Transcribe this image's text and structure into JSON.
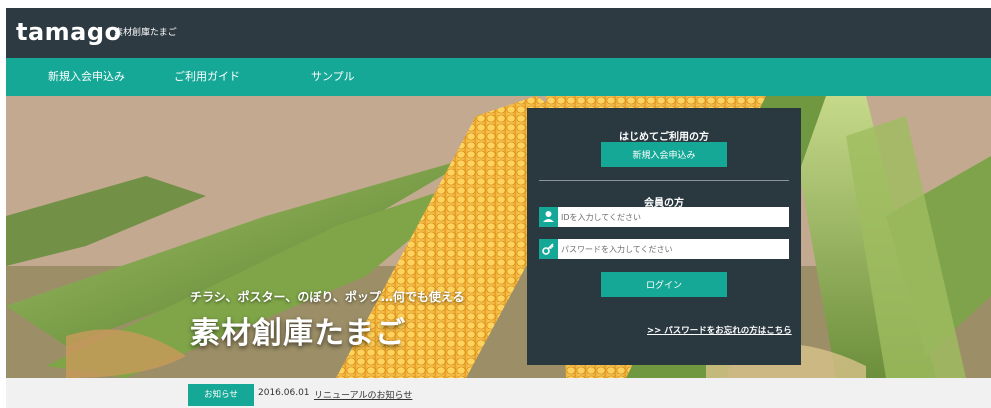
{
  "header": {
    "logo_text": "tamago",
    "logo_tagline": "素材創庫たまご"
  },
  "nav": {
    "items": [
      {
        "label": "新規入会申込み"
      },
      {
        "label": "ご利用ガイド"
      },
      {
        "label": "サンプル"
      }
    ]
  },
  "hero": {
    "subtitle": "チラシ、ポスター、のぼり、ポップ…何でも使える",
    "title": "素材創庫たまご"
  },
  "login_panel": {
    "first_time_heading": "はじめてご利用の方",
    "register_button": "新規入会申込み",
    "member_heading": "会員の方",
    "id_placeholder": "IDを入力してください",
    "password_placeholder": "パスワードを入力してください",
    "login_button": "ログイン",
    "forgot_link": ">> パスワードをお忘れの方はこちら"
  },
  "news": {
    "label": "お知らせ",
    "date": "2016.06.01",
    "link_text": "リニューアルのお知らせ"
  },
  "colors": {
    "header_bg": "#2e3a42",
    "accent_teal": "#16a897",
    "panel_bg": "#2a3840"
  },
  "icons": {
    "id_field": "user-icon",
    "password_field": "key-icon"
  }
}
